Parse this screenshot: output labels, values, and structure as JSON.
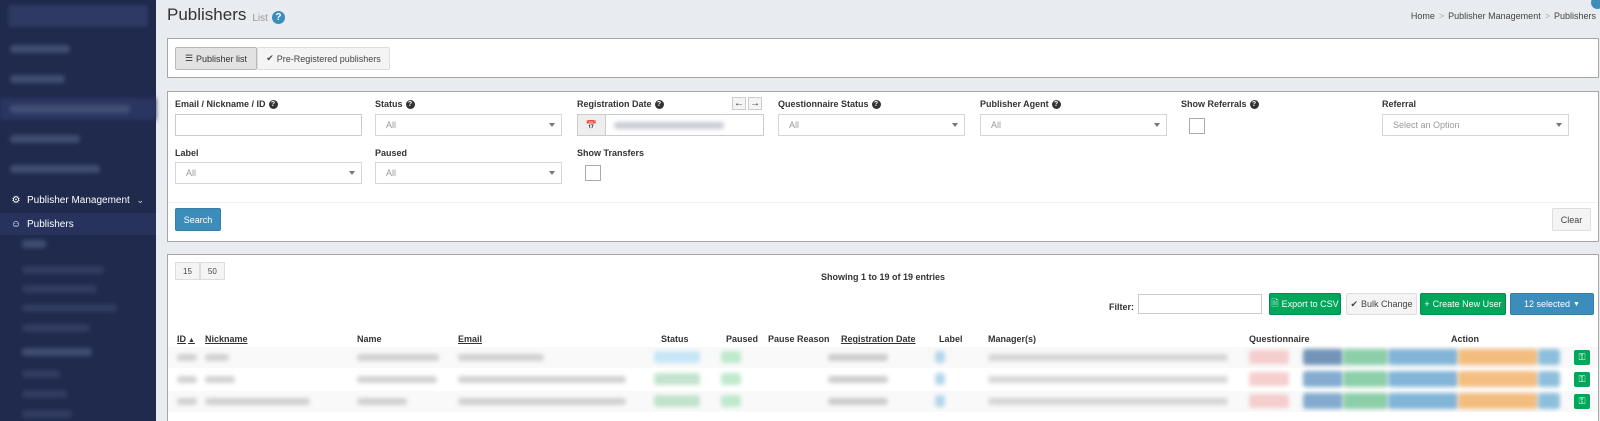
{
  "sidebar": {
    "section": {
      "label": "Publisher Management",
      "icon": "users-cog-icon"
    },
    "active_item": {
      "label": "Publishers",
      "icon": "users-icon"
    }
  },
  "header": {
    "title": "Publishers",
    "subtitle": "List",
    "breadcrumb": [
      "Home",
      "Publisher Management",
      "Publishers"
    ]
  },
  "view_tabs": [
    {
      "label": "Publisher list",
      "icon": "list-icon",
      "active": true
    },
    {
      "label": "Pre-Registered publishers",
      "icon": "check-icon",
      "active": false
    }
  ],
  "filters": {
    "email": {
      "label": "Email / Nickname / ID",
      "value": ""
    },
    "status": {
      "label": "Status",
      "value": "All"
    },
    "registration_date": {
      "label": "Registration Date"
    },
    "questionnaire_status": {
      "label": "Questionnaire Status",
      "value": "All"
    },
    "publisher_agent": {
      "label": "Publisher Agent",
      "value": "All"
    },
    "show_referrals": {
      "label": "Show Referrals",
      "checked": false
    },
    "referral": {
      "label": "Referral",
      "placeholder": "Select an Option"
    },
    "label": {
      "label": "Label",
      "value": "All"
    },
    "paused": {
      "label": "Paused",
      "value": "All"
    },
    "show_transfers": {
      "label": "Show Transfers",
      "checked": false
    },
    "search_label": "Search",
    "clear_label": "Clear"
  },
  "table": {
    "page_sizes": [
      "15",
      "50"
    ],
    "showing": "Showing 1 to 19 of 19 entries",
    "filter_label": "Filter:",
    "filter_value": "",
    "buttons": {
      "export_csv": "Export to CSV",
      "bulk_change": "Bulk Change",
      "create_user": "Create New User",
      "selected": "12 selected"
    },
    "columns": [
      "ID",
      "Nickname",
      "Name",
      "Email",
      "Status",
      "Paused",
      "Pause Reason",
      "Registration Date",
      "Label",
      "Manager(s)",
      "Questionnaire",
      "Action"
    ],
    "sorted_column": "ID",
    "sort_direction": "ascending"
  },
  "colors": {
    "sidebar_bg": "#1f2a4d",
    "primary": "#3c8dbc",
    "success": "#00a65a",
    "warning": "#f39c12"
  }
}
